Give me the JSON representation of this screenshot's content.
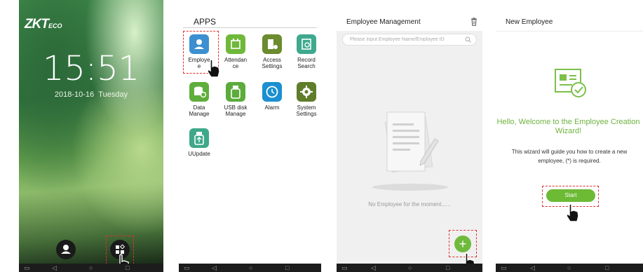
{
  "panel1": {
    "logo_main": "ZKT",
    "logo_sub": "ECO",
    "time": "15:51",
    "date": "2018-10-16",
    "weekday": "Tuesday"
  },
  "panel2": {
    "header": "APPS",
    "apps": [
      {
        "label": "Employe\ne",
        "icon": "employee-icon",
        "color": "#3c8fd0"
      },
      {
        "label": "Attendan\nce",
        "icon": "attendance-icon",
        "color": "#6fb83a"
      },
      {
        "label": "Access\nSettings",
        "icon": "access-settings-icon",
        "color": "#6b8b2e"
      },
      {
        "label": "Record\nSearch",
        "icon": "record-search-icon",
        "color": "#3fa98e"
      },
      {
        "label": "Data\nManage",
        "icon": "data-manage-icon",
        "color": "#5fae3b"
      },
      {
        "label": "USB disk\nManage",
        "icon": "usb-disk-icon",
        "color": "#5cab3c"
      },
      {
        "label": "Alarm",
        "icon": "alarm-icon",
        "color": "#1b8fd0"
      },
      {
        "label": "System\nSettings",
        "icon": "system-settings-icon",
        "color": "#5f7d2a"
      },
      {
        "label": "UUpdate",
        "icon": "uupdate-icon",
        "color": "#3fa889"
      }
    ]
  },
  "panel3": {
    "title": "Employee Management",
    "search_placeholder": "Please Input Employee Name/Employee ID",
    "empty_text": "No Employee for the moment......",
    "fab": "+"
  },
  "panel4": {
    "title": "New Employee",
    "hello": "Hello, Welcome to the Employee Creation Wizard!",
    "guide": "This wizard will guide you how to create a new employee,  (*)  is required.",
    "start": "Start"
  },
  "colors": {
    "accent": "#6dba35",
    "highlight": "#e0302e"
  }
}
